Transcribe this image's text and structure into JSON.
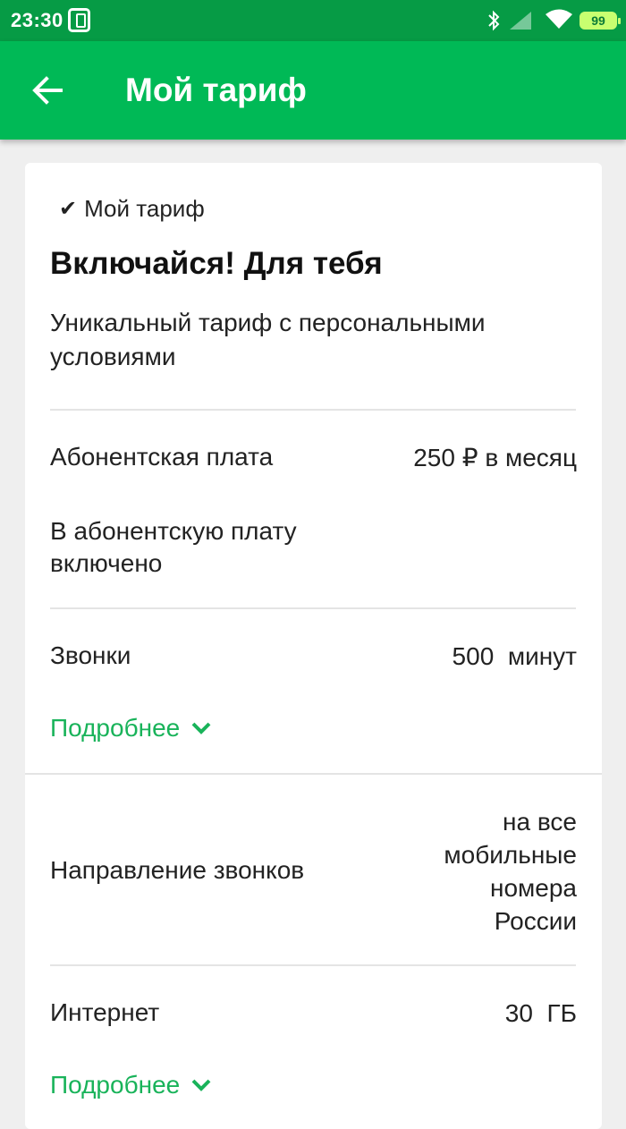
{
  "status_bar": {
    "time": "23:30",
    "battery": "99",
    "icons": [
      "app-icon",
      "bluetooth-icon",
      "signal-icon",
      "wifi-icon",
      "battery-icon"
    ]
  },
  "app_bar": {
    "title": "Мой тариф",
    "back_icon": "arrow-left-icon",
    "color": "#00b956"
  },
  "card": {
    "badge": "Мой тариф",
    "name": "Включайся! Для тебя",
    "description": "Уникальный тариф с персональными условиями",
    "fee_label": "Абонентская плата",
    "fee_value": "250 ₽ в месяц",
    "included_label": "В абонентскую плату включено",
    "calls_label": "Звонки",
    "calls_value": "500  минут",
    "calls_more": "Подробнее",
    "direction_label": "Направление звонков",
    "direction_value": [
      "на все",
      "мобильные",
      "номера",
      "России"
    ],
    "internet_label": "Интернет",
    "internet_value": "30  ГБ",
    "internet_more": "Подробнее"
  },
  "colors": {
    "accent": "#00b956",
    "status_bar": "#069b45",
    "link": "#19b35a",
    "background": "#efefef"
  }
}
